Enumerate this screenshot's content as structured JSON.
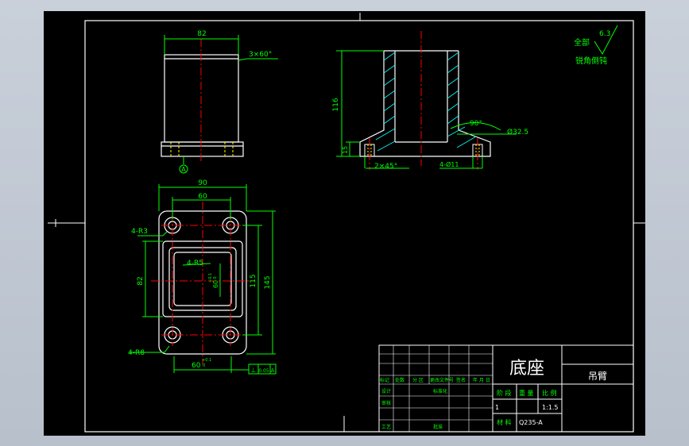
{
  "drawing": {
    "top_view": {
      "width_dim": "82",
      "chamfer_note": "3×60°",
      "datum_label": "A"
    },
    "front_section": {
      "height_dim": "116",
      "base_dim": "15",
      "angle_dim": "90°",
      "dia_dim": "Ø32.5",
      "chamfer_dim": "2×45°",
      "holes_dim": "4-Ø11"
    },
    "plan_view": {
      "outer_width": "90",
      "hole_spacing": "60",
      "corner_r3": "4-R3",
      "inner_r5": "4-R5",
      "corner_r8": "4-R8",
      "left_dim": "82",
      "height_115": "115",
      "height_145": "145",
      "inner_tol": "60",
      "inner_tol_sup": "+0.1",
      "inner_tol_sub": "0",
      "bottom_tol": "60",
      "bottom_tol_sup": "+0.1",
      "bottom_tol_sub": "0",
      "perp_symbol": "⊥",
      "perp_value": "0.05",
      "perp_datum": "A"
    },
    "roughness": {
      "scope": "全部",
      "value": "6.3",
      "note": "锐角倒钝"
    }
  },
  "title_block": {
    "part_name": "底座",
    "assembly_name": "吊臂",
    "header_cells": [
      "标记",
      "处数",
      "分 区",
      "更改文件号",
      "签名",
      "年 月 日"
    ],
    "row_design": "设计",
    "row_std": "标准化",
    "row_check": "审核",
    "row_process": "工艺",
    "row_approve": "批准",
    "stage_label": "阶 段",
    "weight_label": "重 量",
    "scale_label": "比 例",
    "stage_value": "1",
    "scale_value": "1:1.5",
    "material_label": "材 料",
    "material_value": "Q235-A"
  },
  "colors": {
    "background": "#000000",
    "outline": "#ffffff",
    "dimension": "#00ff00",
    "centerline": "#ff0000",
    "hatch": "#00ffff",
    "hidden": "#ffff00"
  }
}
